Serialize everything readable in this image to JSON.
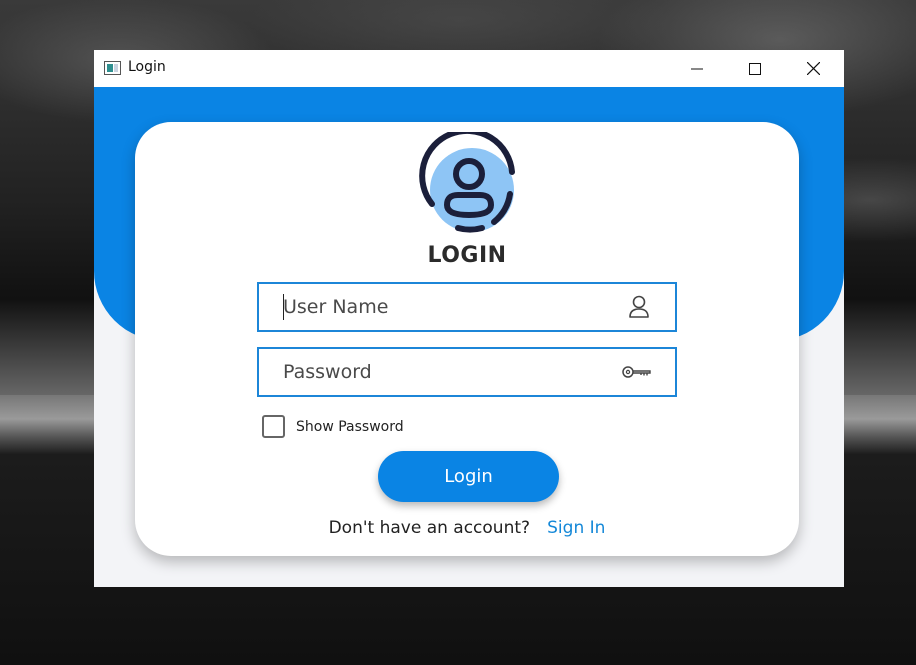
{
  "window": {
    "title": "Login",
    "icon": "app-window-icon",
    "controls": [
      "minimize-icon",
      "maximize-icon",
      "close-icon"
    ]
  },
  "form": {
    "heading": "LOGIN",
    "avatar_icon": "user-avatar-icon",
    "username": {
      "placeholder": "User Name",
      "value": "",
      "icon": "user-icon"
    },
    "password": {
      "placeholder": "Password",
      "value": "",
      "icon": "key-icon"
    },
    "show_password": {
      "label": "Show Password",
      "checked": false
    },
    "submit_label": "Login",
    "signup_prompt": "Don't have an account?",
    "signup_link": "Sign In"
  },
  "colors": {
    "accent": "#0a84e4",
    "field_border": "#1c86d8",
    "link": "#1488d8",
    "avatar_fill": "#8ec5f5",
    "avatar_stroke": "#1b1f3a"
  }
}
